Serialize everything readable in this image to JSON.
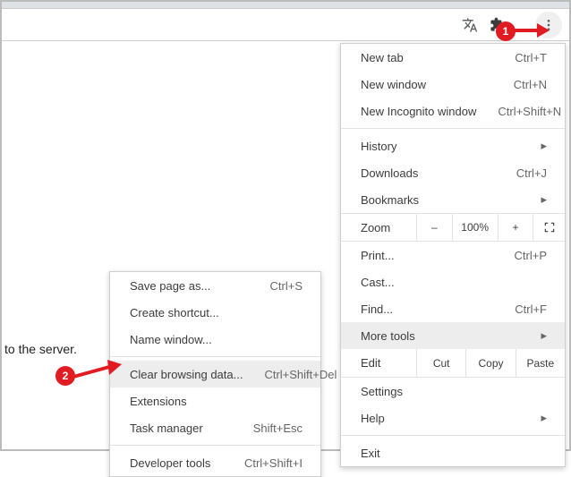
{
  "page": {
    "snippet": "to the server."
  },
  "main_menu": {
    "new_tab": "New tab",
    "new_tab_sc": "Ctrl+T",
    "new_window": "New window",
    "new_window_sc": "Ctrl+N",
    "new_incognito": "New Incognito window",
    "new_incognito_sc": "Ctrl+Shift+N",
    "history": "History",
    "downloads": "Downloads",
    "downloads_sc": "Ctrl+J",
    "bookmarks": "Bookmarks",
    "zoom_label": "Zoom",
    "zoom_minus": "–",
    "zoom_value": "100%",
    "zoom_plus": "+",
    "print": "Print...",
    "print_sc": "Ctrl+P",
    "cast": "Cast...",
    "find": "Find...",
    "find_sc": "Ctrl+F",
    "more_tools": "More tools",
    "edit_label": "Edit",
    "cut": "Cut",
    "copy": "Copy",
    "paste": "Paste",
    "settings": "Settings",
    "help": "Help",
    "exit": "Exit"
  },
  "sub_menu": {
    "save_page": "Save page as...",
    "save_page_sc": "Ctrl+S",
    "create_shortcut": "Create shortcut...",
    "name_window": "Name window...",
    "clear_browsing": "Clear browsing data...",
    "clear_browsing_sc": "Ctrl+Shift+Del",
    "extensions": "Extensions",
    "task_manager": "Task manager",
    "task_manager_sc": "Shift+Esc",
    "dev_tools": "Developer tools",
    "dev_tools_sc": "Ctrl+Shift+I"
  },
  "annotations": {
    "badge1": "1",
    "badge2": "2"
  }
}
